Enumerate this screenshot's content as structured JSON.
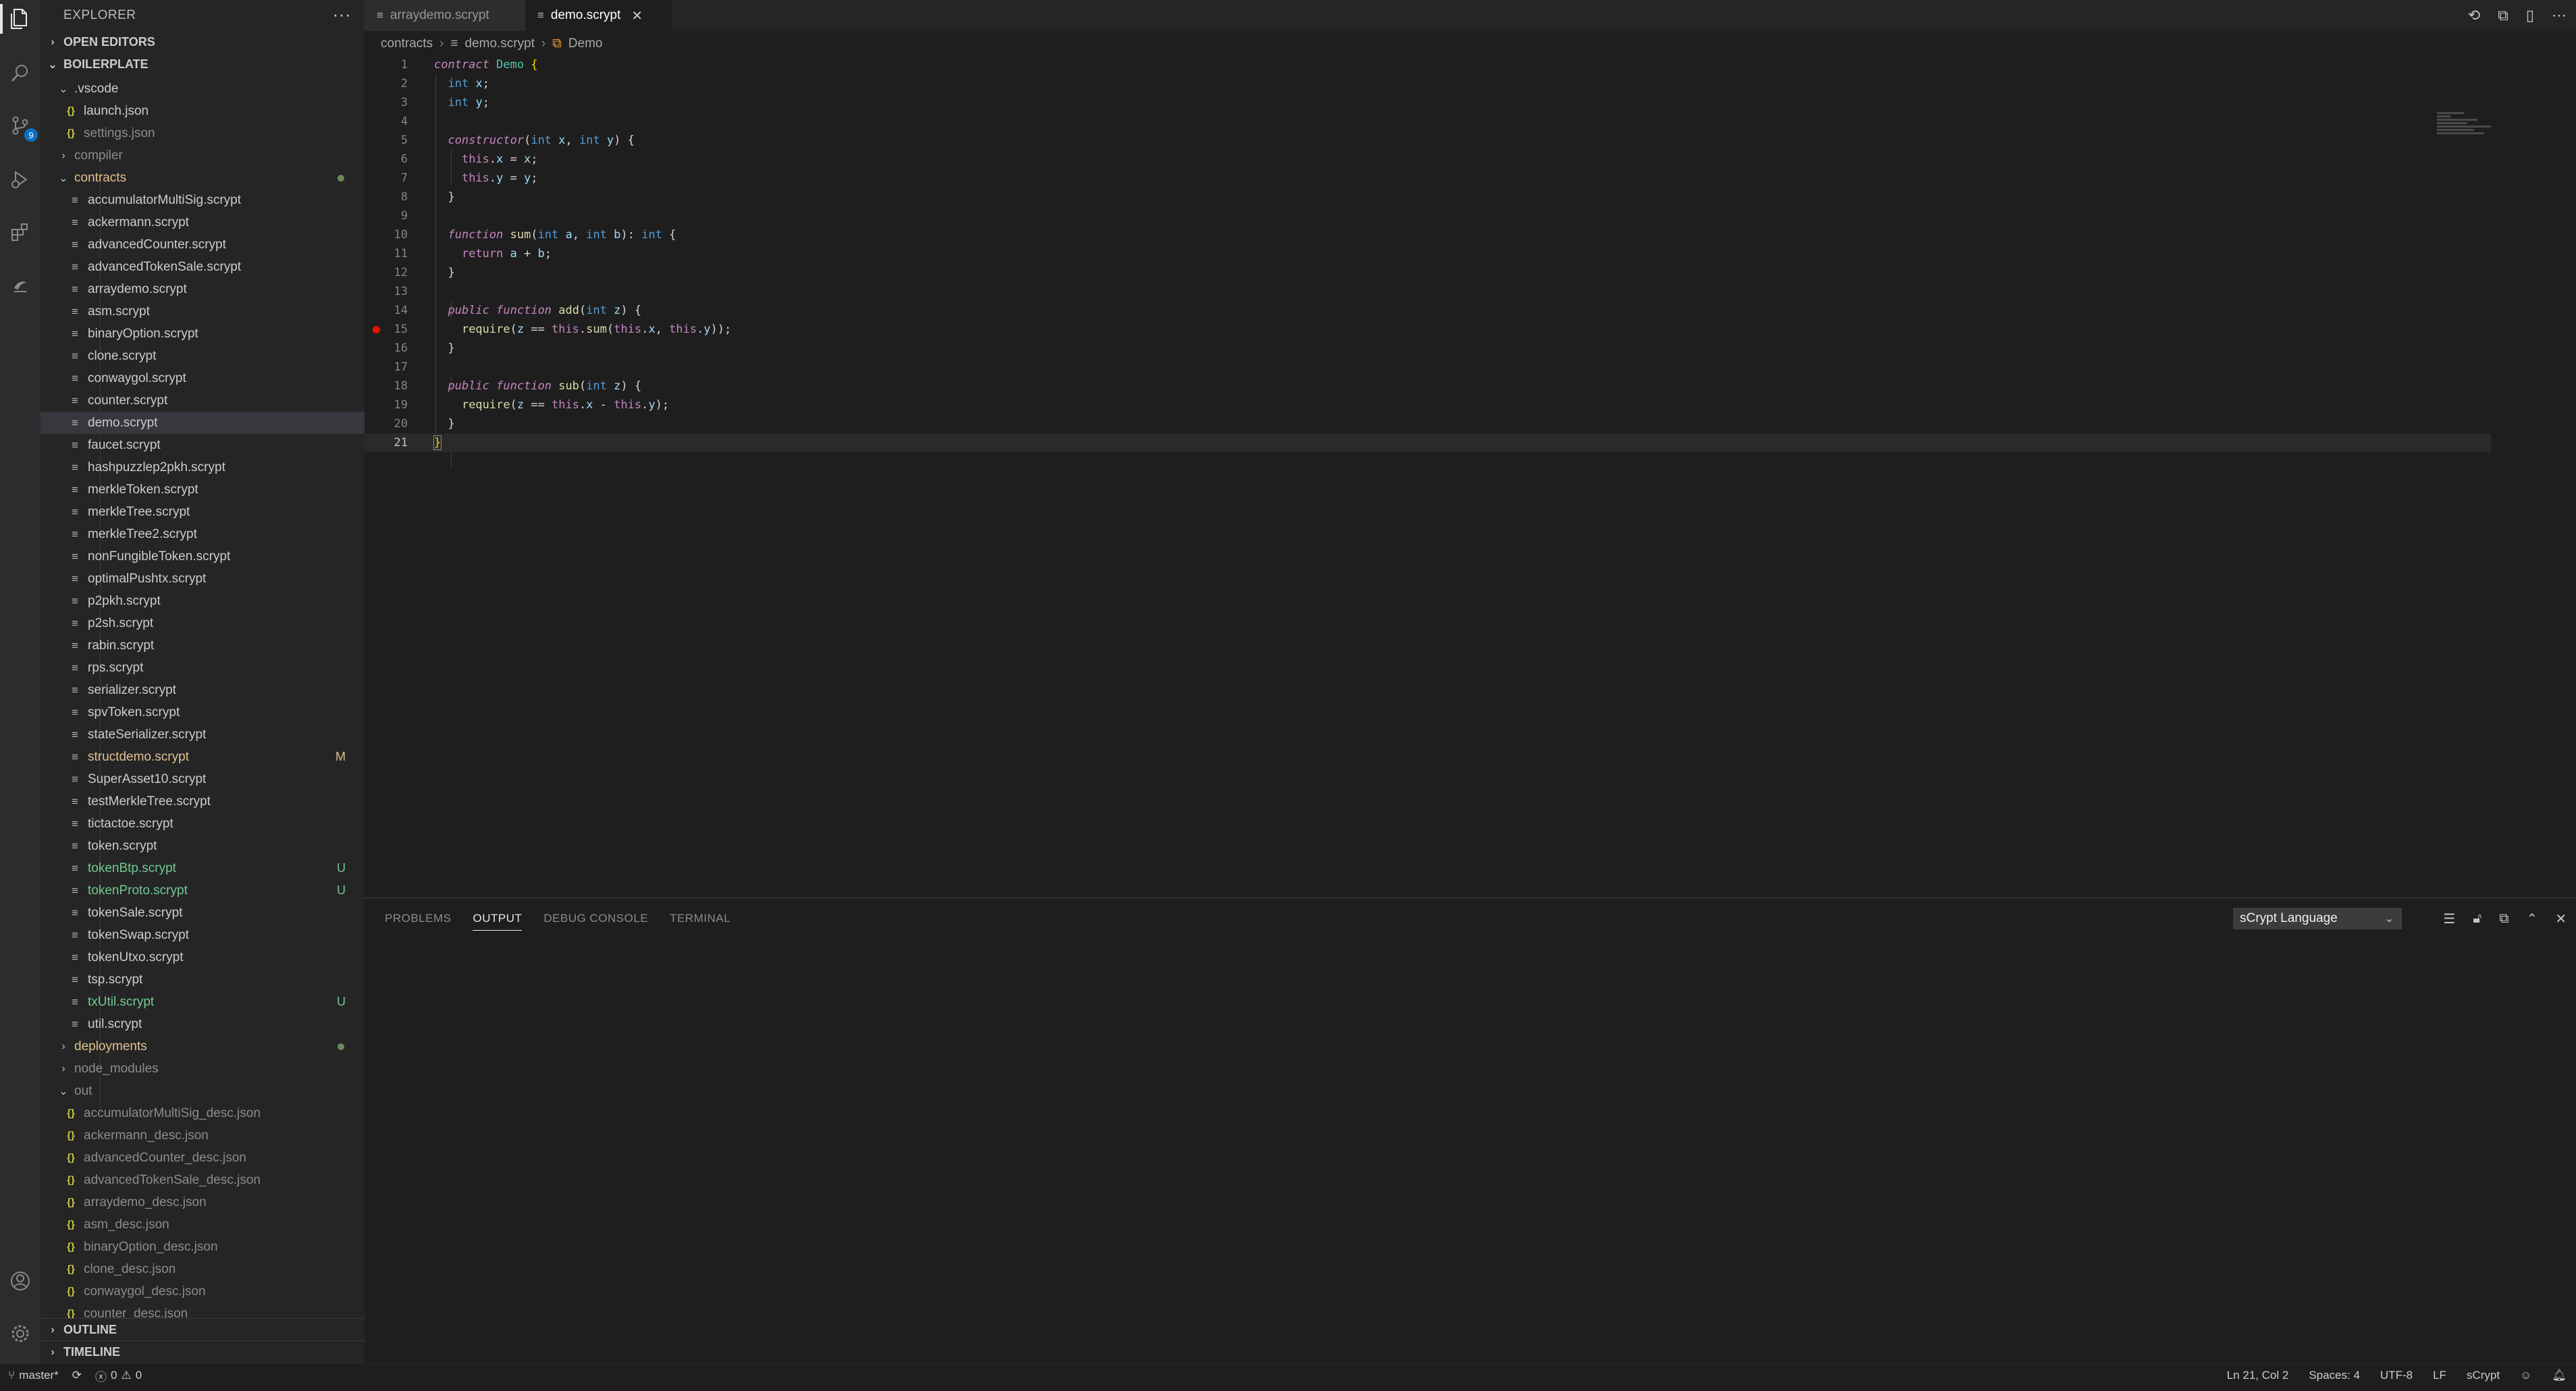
{
  "explorer": {
    "title": "EXPLORER",
    "more_label": "···",
    "open_editors": "OPEN EDITORS",
    "workspace": "BOILERPLATE",
    "outline": "OUTLINE",
    "timeline": "TIMELINE"
  },
  "activity": {
    "scm_badge": "9"
  },
  "tree": {
    "vscode": ".vscode",
    "launch": "launch.json",
    "settings": "settings.json",
    "compiler": "compiler",
    "contracts": "contracts",
    "files": [
      {
        "name": "accumulatorMultiSig.scrypt",
        "status": ""
      },
      {
        "name": "ackermann.scrypt",
        "status": ""
      },
      {
        "name": "advancedCounter.scrypt",
        "status": ""
      },
      {
        "name": "advancedTokenSale.scrypt",
        "status": ""
      },
      {
        "name": "arraydemo.scrypt",
        "status": ""
      },
      {
        "name": "asm.scrypt",
        "status": ""
      },
      {
        "name": "binaryOption.scrypt",
        "status": ""
      },
      {
        "name": "clone.scrypt",
        "status": ""
      },
      {
        "name": "conwaygol.scrypt",
        "status": ""
      },
      {
        "name": "counter.scrypt",
        "status": ""
      },
      {
        "name": "demo.scrypt",
        "status": "",
        "selected": true
      },
      {
        "name": "faucet.scrypt",
        "status": ""
      },
      {
        "name": "hashpuzzlep2pkh.scrypt",
        "status": ""
      },
      {
        "name": "merkleToken.scrypt",
        "status": ""
      },
      {
        "name": "merkleTree.scrypt",
        "status": ""
      },
      {
        "name": "merkleTree2.scrypt",
        "status": ""
      },
      {
        "name": "nonFungibleToken.scrypt",
        "status": ""
      },
      {
        "name": "optimalPushtx.scrypt",
        "status": ""
      },
      {
        "name": "p2pkh.scrypt",
        "status": ""
      },
      {
        "name": "p2sh.scrypt",
        "status": ""
      },
      {
        "name": "rabin.scrypt",
        "status": ""
      },
      {
        "name": "rps.scrypt",
        "status": ""
      },
      {
        "name": "serializer.scrypt",
        "status": ""
      },
      {
        "name": "spvToken.scrypt",
        "status": ""
      },
      {
        "name": "stateSerializer.scrypt",
        "status": ""
      },
      {
        "name": "structdemo.scrypt",
        "status": "M"
      },
      {
        "name": "SuperAsset10.scrypt",
        "status": ""
      },
      {
        "name": "testMerkleTree.scrypt",
        "status": ""
      },
      {
        "name": "tictactoe.scrypt",
        "status": ""
      },
      {
        "name": "token.scrypt",
        "status": ""
      },
      {
        "name": "tokenBtp.scrypt",
        "status": "U"
      },
      {
        "name": "tokenProto.scrypt",
        "status": "U"
      },
      {
        "name": "tokenSale.scrypt",
        "status": ""
      },
      {
        "name": "tokenSwap.scrypt",
        "status": ""
      },
      {
        "name": "tokenUtxo.scrypt",
        "status": ""
      },
      {
        "name": "tsp.scrypt",
        "status": ""
      },
      {
        "name": "txUtil.scrypt",
        "status": "U"
      },
      {
        "name": "util.scrypt",
        "status": ""
      }
    ],
    "deployments": "deployments",
    "node_modules": "node_modules",
    "out": "out",
    "out_files": [
      "accumulatorMultiSig_desc.json",
      "ackermann_desc.json",
      "advancedCounter_desc.json",
      "advancedTokenSale_desc.json",
      "arraydemo_desc.json",
      "asm_desc.json",
      "binaryOption_desc.json",
      "clone_desc.json",
      "conwaygol_desc.json",
      "counter_desc.json"
    ]
  },
  "tabs": [
    {
      "label": "arraydemo.scrypt",
      "active": false
    },
    {
      "label": "demo.scrypt",
      "active": true
    }
  ],
  "breadcrumb": {
    "folder": "contracts",
    "file": "demo.scrypt",
    "symbol": "Demo"
  },
  "editor": {
    "line_numbers": [
      "1",
      "2",
      "3",
      "4",
      "5",
      "6",
      "7",
      "8",
      "9",
      "10",
      "11",
      "12",
      "13",
      "14",
      "15",
      "16",
      "17",
      "18",
      "19",
      "20",
      "21"
    ],
    "current_line": 21,
    "breakpoint_line": 15
  },
  "panel": {
    "tabs": [
      "PROBLEMS",
      "OUTPUT",
      "DEBUG CONSOLE",
      "TERMINAL"
    ],
    "active_tab": "OUTPUT",
    "channel": "sCrypt Language"
  },
  "status": {
    "branch": "master*",
    "errors": "0",
    "warnings": "0",
    "cursor": "Ln 21, Col 2",
    "spaces": "Spaces: 4",
    "encoding": "UTF-8",
    "eol": "LF",
    "language": "sCrypt"
  }
}
